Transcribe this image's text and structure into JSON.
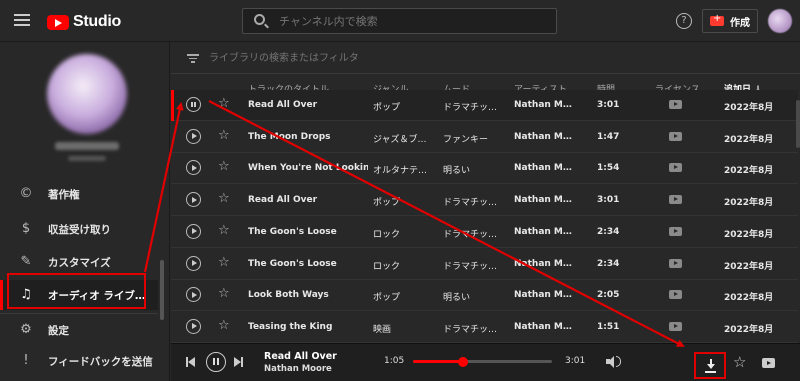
{
  "app": {
    "name": "Studio"
  },
  "search": {
    "placeholder": "チャンネル内で検索"
  },
  "header": {
    "create_label": "作成",
    "help": "?"
  },
  "sidebar": {
    "items": [
      {
        "label": "著作権",
        "icon": "copyright-icon",
        "glyph": "©"
      },
      {
        "label": "収益受け取り",
        "icon": "dollar-icon",
        "glyph": "$"
      },
      {
        "label": "カスタマイズ",
        "icon": "magic-wand-icon",
        "glyph": "✎"
      },
      {
        "label": "オーディオ ライブ…",
        "icon": "audio-library-icon",
        "glyph": "♫",
        "active": true
      },
      {
        "label": "設定",
        "icon": "gear-icon",
        "glyph": "⚙"
      },
      {
        "label": "フィードバックを送信",
        "icon": "feedback-icon",
        "glyph": "!"
      }
    ]
  },
  "filter": {
    "placeholder": "ライブラリの検索またはフィルタ"
  },
  "table": {
    "columns": [
      "トラックのタイトル",
      "ジャンル",
      "ムード",
      "アーティスト",
      "時間",
      "ライセンス…",
      "追加日"
    ],
    "sort_column": "追加日",
    "rows": [
      {
        "title": "Read All Over",
        "genre": "ポップ",
        "mood": "ドラマチッ…",
        "artist": "Nathan M…",
        "duration": "3:01",
        "date": "2022年8月",
        "playing": true
      },
      {
        "title": "The Moon Drops",
        "genre": "ジャズ＆ブ…",
        "mood": "ファンキー",
        "artist": "Nathan M…",
        "duration": "1:47",
        "date": "2022年8月"
      },
      {
        "title": "When You're Not Looking",
        "genre": "オルタナテ…",
        "mood": "明るい",
        "artist": "Nathan M…",
        "duration": "1:54",
        "date": "2022年8月"
      },
      {
        "title": "Read All Over",
        "genre": "ポップ",
        "mood": "ドラマチッ…",
        "artist": "Nathan M…",
        "duration": "3:01",
        "date": "2022年8月"
      },
      {
        "title": "The Goon's Loose",
        "genre": "ロック",
        "mood": "ドラマチッ…",
        "artist": "Nathan M…",
        "duration": "2:34",
        "date": "2022年8月"
      },
      {
        "title": "The Goon's Loose",
        "genre": "ロック",
        "mood": "ドラマチッ…",
        "artist": "Nathan M…",
        "duration": "2:34",
        "date": "2022年8月"
      },
      {
        "title": "Look Both Ways",
        "genre": "ポップ",
        "mood": "明るい",
        "artist": "Nathan M…",
        "duration": "2:05",
        "date": "2022年8月"
      },
      {
        "title": "Teasing the King",
        "genre": "映画",
        "mood": "ドラマチッ…",
        "artist": "Nathan M…",
        "duration": "1:51",
        "date": "2022年8月"
      }
    ]
  },
  "player": {
    "title": "Read All Over",
    "artist": "Nathan Moore",
    "current_time": "1:05",
    "total_time": "3:01",
    "progress": 0.36
  },
  "colors": {
    "accent": "#ff0000",
    "annotation": "#e00000",
    "background": "#282828"
  }
}
